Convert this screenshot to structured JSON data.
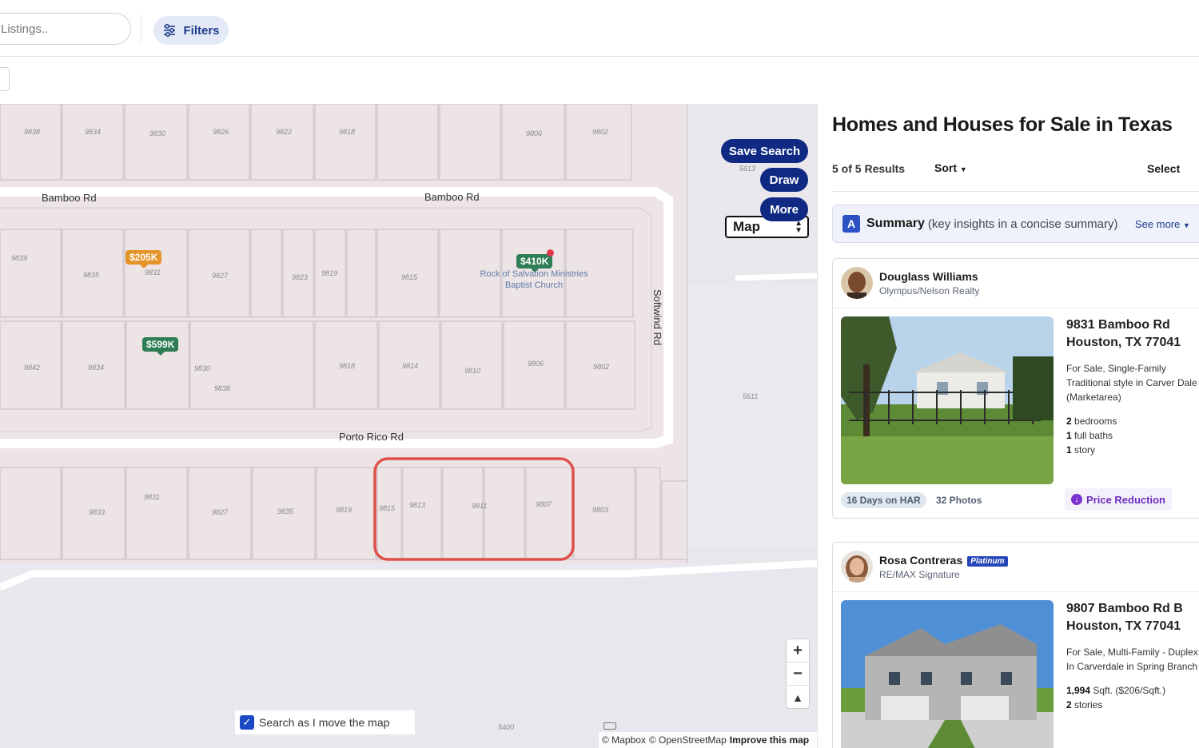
{
  "topbar": {
    "search_placeholder": "Listings..",
    "filters_label": "Filters"
  },
  "map": {
    "streets": {
      "bamboo_left": "Bamboo Rd",
      "bamboo_right": "Bamboo Rd",
      "porto_rico": "Porto Rico Rd",
      "softwind": "Softwind Rd"
    },
    "poi": {
      "line1": "Rock of Salvation Ministries",
      "line2": "Baptist Church"
    },
    "pins": {
      "p1": "$205K",
      "p2": "$410K",
      "p3": "$599K"
    },
    "view_select": "Map",
    "save_search": "Save Search",
    "draw": "Draw",
    "more": "More",
    "zoom_in": "+",
    "zoom_out": "−",
    "compass": "▲",
    "search_as_move": "Search as I move the map",
    "attribution": {
      "mapbox": "© Mapbox",
      "osm": "© OpenStreetMap",
      "improve": "Improve this map"
    },
    "lot_numbers": {
      "r1": [
        "9838",
        "9834",
        "9830",
        "9826",
        "9822",
        "9818",
        "9806",
        "9802"
      ],
      "r2": [
        "9839",
        "9835",
        "9831",
        "9827",
        "9823",
        "9819",
        "9815"
      ],
      "r3": [
        "9842",
        "9834",
        "9830",
        "9838",
        "9818",
        "9814",
        "9810",
        "9806",
        "9802"
      ],
      "r4": [
        "9833",
        "9831",
        "9827",
        "9835",
        "9819",
        "9815",
        "9813",
        "9811",
        "9807",
        "9803"
      ],
      "misc": [
        "5613",
        "5611",
        "5400"
      ]
    }
  },
  "panel": {
    "title": "Homes and Houses for Sale in Texas",
    "results": "5 of 5 Results",
    "sort": "Sort",
    "select": "Select",
    "summary_logo": "A",
    "summary_title": "Summary",
    "summary_sub": "(key insights in a concise summary)",
    "see_more": "See more",
    "listings": [
      {
        "agent": "Douglass Williams",
        "company": "Olympus/Nelson Realty",
        "address1": "9831 Bamboo Rd",
        "address2": "Houston, TX 77041",
        "desc1": "For Sale, Single-Family",
        "desc2": "Traditional style in Carver Dale",
        "desc3": "(Marketarea)",
        "f1n": "2",
        "f1t": " bedrooms",
        "f2n": "1",
        "f2t": " full baths",
        "f3n": "1",
        "f3t": " story",
        "days": "16 Days on HAR",
        "photos": "32 Photos",
        "price_reduction": "Price Reduction"
      },
      {
        "agent": "Rosa Contreras",
        "badge": "Platinum",
        "company": "RE/MAX Signature",
        "address1": "9807 Bamboo Rd B",
        "address2": "Houston, TX 77041",
        "desc1": "For Sale, Multi-Family - Duplex",
        "desc2": "In Carverdale in Spring Branch",
        "f1n": "1,994",
        "f1t": " Sqft. ($206/Sqft.)",
        "f2n": "2",
        "f2t": " stories"
      }
    ]
  }
}
